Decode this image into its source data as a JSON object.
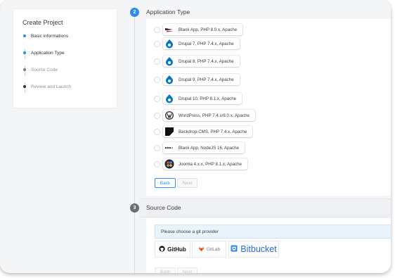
{
  "steps_panel": {
    "title": "Create Project",
    "steps": [
      {
        "label": "Basic informations",
        "state": "done",
        "color": "#2d8cf0"
      },
      {
        "label": "Application Type",
        "state": "current",
        "color": "#2d8cf0"
      },
      {
        "label": "Source Code",
        "state": "pending",
        "color": "#7a7f87"
      },
      {
        "label": "Review and Launch",
        "state": "pending",
        "color": "#7a7f87"
      }
    ]
  },
  "app_section": {
    "number": "2",
    "title": "Application Type",
    "options": [
      {
        "label": "Blank App, PHP 8.0.x, Apache",
        "icon": "php-app-icon"
      },
      {
        "label": "Drupal 7, PHP 7.4.x, Apache",
        "icon": "drupal-icon"
      },
      {
        "label": "Drupal 8, PHP 7.4.x, Apache",
        "icon": "drupal-icon"
      },
      {
        "label": "Drupal 9, PHP 7.4.x, Apache",
        "icon": "drupal-icon"
      },
      {
        "label": "Drupal 10, PHP 8.1.x, Apache",
        "icon": "drupal-icon"
      },
      {
        "label": "WordPress, PHP 7.4.x/8.0.x, Apache",
        "icon": "wordpress-icon"
      },
      {
        "label": "Backdrop-CMS, PHP 7.4.x, Apache",
        "icon": "backdrop-icon"
      },
      {
        "label": "Blank App, NodeJS 16, Apache",
        "icon": "node-icon"
      },
      {
        "label": "Joomla 4.x.x, PHP 8.1.x, Apache",
        "icon": "joomla-icon"
      }
    ],
    "back_label": "Back",
    "next_label": "Next"
  },
  "source_section": {
    "number": "3",
    "title": "Source Code",
    "prompt": "Please choose a git provider",
    "providers": {
      "github": "GitHub",
      "gitlab": "GitLab",
      "bitbucket": "Bitbucket"
    },
    "back_label": "Back",
    "next_label": "Next"
  },
  "colors": {
    "accent": "#2d8cf0",
    "muted": "#7a7f87",
    "step3_circle": "#6b6f75"
  }
}
